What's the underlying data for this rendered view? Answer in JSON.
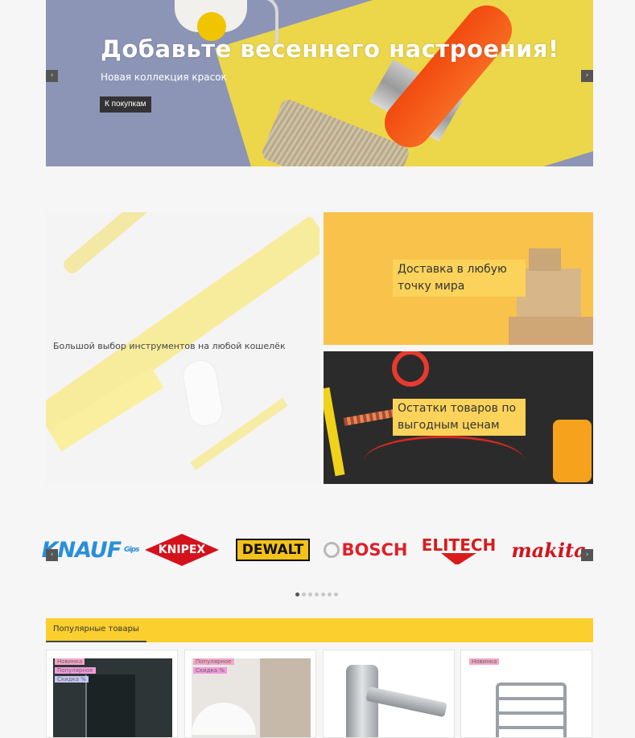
{
  "hero": {
    "title": "Добавьте весеннего настроения!",
    "subtitle": "Новая коллекция красок",
    "cta_label": "К покупкам",
    "prev_glyph": "‹",
    "next_glyph": "›"
  },
  "promos": {
    "tools_caption": "Большой выбор инструментов на любой кошелёк",
    "delivery_label": "Доставка в любую точку мира",
    "leftovers_label": "Остатки товаров по выгодным ценам"
  },
  "brands": {
    "items": [
      "KNAUF",
      "KNIPEX",
      "DEWALT",
      "BOSCH",
      "ELITECH",
      "makita"
    ],
    "knauf_sub": "Gips",
    "prev_glyph": "‹",
    "next_glyph": "›",
    "page_count": 7,
    "active_page": 1
  },
  "popular": {
    "tab_label": "Популярные товары",
    "cards": [
      {
        "badges": [
          "Новинка",
          "Популярное",
          "Скидка %"
        ]
      },
      {
        "badges": [
          "Популярное",
          "Скидка %"
        ]
      },
      {
        "badges": []
      },
      {
        "badges": [
          "Новинка"
        ]
      }
    ]
  },
  "colors": {
    "accent": "#fbcf2e",
    "dark_button": "#333333",
    "badge_new": "#f5a6c7",
    "badge_hit": "#f49bde",
    "badge_sale": "#c5c7f4"
  }
}
